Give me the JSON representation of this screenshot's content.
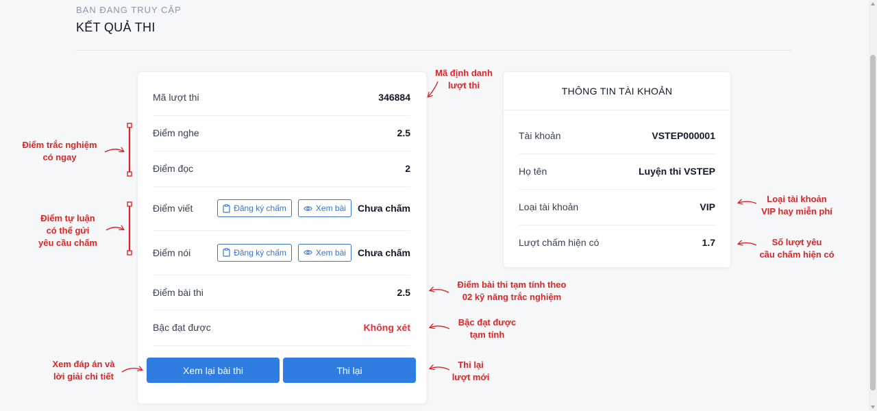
{
  "header": {
    "breadcrumb": "BẠN ĐANG TRUY CẬP",
    "title": "KẾT QUẢ THI"
  },
  "result": {
    "attempt_id_label": "Mã lượt thi",
    "attempt_id_value": "346884",
    "listening_label": "Điểm nghe",
    "listening_value": "2.5",
    "reading_label": "Điểm đọc",
    "reading_value": "2",
    "writing_label": "Điểm viết",
    "writing_status": "Chưa chấm",
    "speaking_label": "Điểm nói",
    "speaking_status": "Chưa chấm",
    "register_grading_label": "Đăng ký chấm",
    "view_label": "Xem bài",
    "total_label": "Điểm bài thi",
    "total_value": "2.5",
    "level_label": "Bậc đạt được",
    "level_value": "Không xét",
    "review_button": "Xem lại bài thi",
    "retake_button": "Thi lại"
  },
  "account": {
    "title": "THÔNG TIN TÀI KHOẢN",
    "username_label": "Tài khoản",
    "username_value": "VSTEP000001",
    "fullname_label": "Họ tên",
    "fullname_value": "Luyện thi VSTEP",
    "type_label": "Loại tài khoản",
    "type_value": "VIP",
    "credits_label": "Lượt chấm hiện có",
    "credits_value": "1.7"
  },
  "annotations": {
    "attempt_id": [
      "Mã định danh",
      "lượt thi"
    ],
    "mcq_scores": [
      "Điểm trắc nghiệm",
      "có ngay"
    ],
    "essay_scores": [
      "Điểm tự luận",
      "có thể gửi",
      "yêu cầu chấm"
    ],
    "temp_total": [
      "Điểm bài thi tạm tính theo",
      "02 kỹ năng trắc nghiệm"
    ],
    "temp_level": [
      "Bậc đạt được",
      "tạm tính"
    ],
    "review": [
      "Xem đáp án và",
      "lời giải chi tiết"
    ],
    "retake": [
      "Thi lại",
      "lượt mới"
    ],
    "account_type": [
      "Loại tài khoản",
      "VIP hay miễn phí"
    ],
    "credits": [
      "Số lượt yêu",
      "cầu chấm hiện có"
    ]
  },
  "colors": {
    "accent": "#2f7de1",
    "annotation": "#dd2424",
    "level_value": "#e0303a"
  },
  "icons": [
    "clipboard-icon",
    "eye-icon"
  ]
}
